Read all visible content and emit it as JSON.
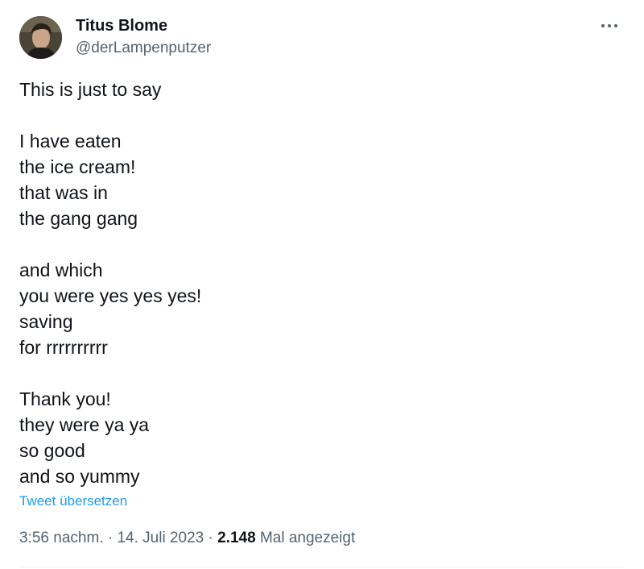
{
  "author": {
    "display_name": "Titus Blome",
    "handle": "@derLampenputzer"
  },
  "menu": {
    "icon": "more-horizontal-icon"
  },
  "tweet": {
    "lines": [
      "This is just to say",
      "",
      "I have eaten",
      "the ice cream!",
      "that was in",
      "the gang gang",
      "",
      "and which",
      "you were yes yes yes!",
      "saving",
      "for rrrrrrrrrr",
      "",
      "Thank you!",
      "they were ya ya",
      "so good",
      "and so yummy"
    ],
    "translate_label": "Tweet übersetzen"
  },
  "meta": {
    "time": "3:56 nachm.",
    "separator": "·",
    "date": "14. Juli 2023",
    "views_count": "2.148",
    "views_label": "Mal angezeigt"
  },
  "colors": {
    "text": "#0f1419",
    "secondary": "#536471",
    "link": "#1d9bf0"
  }
}
